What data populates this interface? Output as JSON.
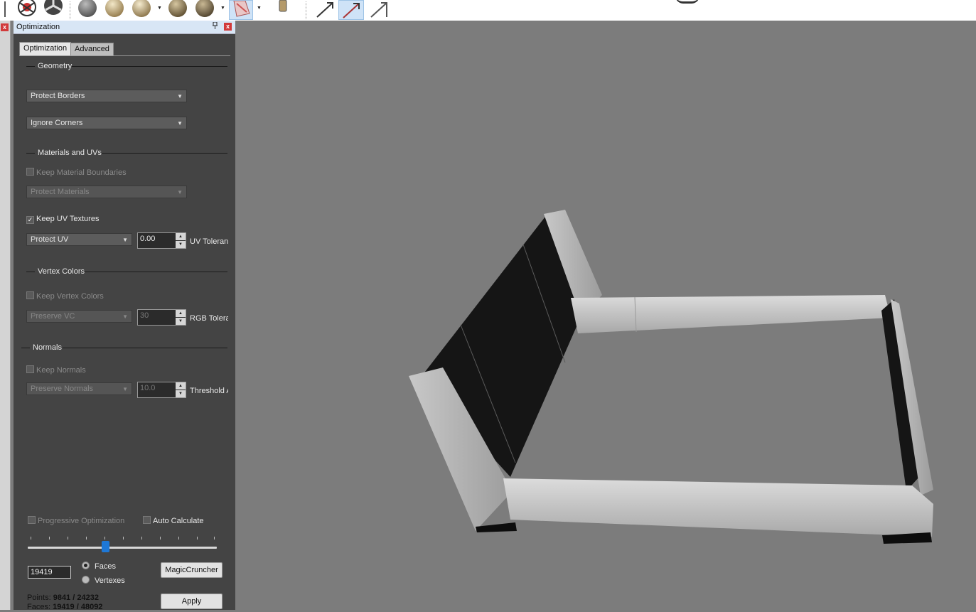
{
  "panel": {
    "title": "Optimization",
    "pin_icon": "pin-icon",
    "close_glyph": "x",
    "tabs": [
      "Optimization",
      "Advanced"
    ],
    "geometry": {
      "header": "Geometry",
      "borders": "Protect Borders",
      "corners": "Ignore Corners"
    },
    "materials": {
      "header": "Materials and UVs",
      "keep_material_boundaries": "Keep Material Boundaries",
      "protect_materials": "Protect Materials",
      "keep_uv_textures": "Keep UV Textures",
      "protect_uv": "Protect UV",
      "uv_tolerance_value": "0.00",
      "uv_tolerance_label": "UV Toleranc"
    },
    "vertex_colors": {
      "header": "Vertex Colors",
      "keep_vertex_colors": "Keep Vertex Colors",
      "preserve_vc": "Preserve VC",
      "rgb_value": "30",
      "rgb_label": "RGB Tolera"
    },
    "normals": {
      "header": "Normals",
      "keep_normals": "Keep Normals",
      "preserve_normals": "Preserve Normals",
      "threshold_value": "10.0",
      "threshold_label": "Threshold A"
    },
    "bottom": {
      "progressive": "Progressive Optimization",
      "auto_calculate": "Auto Calculate",
      "slider_fraction": 0.41,
      "face_count": "19419",
      "faces_radio": "Faces",
      "vertexes_radio": "Vertexes",
      "magic_button": "MagicCruncher",
      "apply_button": "Apply",
      "points_label": "Points:",
      "points_value": "9841 / 24232",
      "faces_label": "Faces:",
      "faces_value": "19419 / 48092"
    }
  },
  "colors": {
    "panel_bg": "#444444",
    "viewport_bg": "#7c7c7c",
    "accent": "#1e78d7"
  }
}
